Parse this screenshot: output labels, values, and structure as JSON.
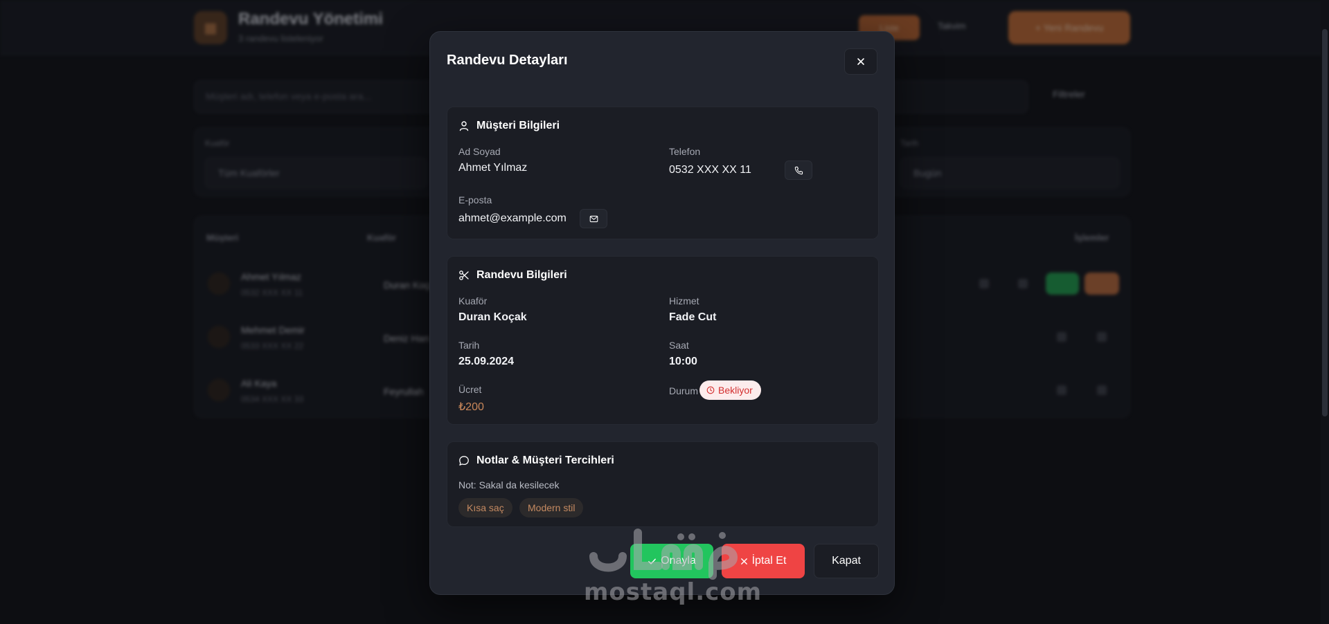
{
  "background": {
    "app_title": "Randevu Yönetimi",
    "app_subtitle": "3 randevu listeleniyor",
    "header_btn_small": "Liste",
    "header_link": "Takvim",
    "header_btn_primary": "+ Yeni Randevu",
    "search_placeholder": "Müşteri adı, telefon veya e-posta ara...",
    "filters_label": "Filtreler",
    "filter_barber_label": "Kuaför",
    "filter_barber_value": "Tüm Kuaförler",
    "filter_date_label": "Tarih",
    "filter_date_value": "Bugün",
    "table_headers": [
      "Müşteri",
      "Kuaför",
      "",
      "İşlemler"
    ],
    "rows": [
      {
        "name": "Ahmet Yılmaz",
        "phone": "0532 XXX XX 11",
        "barber": "Duran Koçak"
      },
      {
        "name": "Mehmet Demir",
        "phone": "0533 XXX XX 22",
        "barber": "Deniz Han"
      },
      {
        "name": "Ali Kaya",
        "phone": "0534 XXX XX 33",
        "barber": "Feyrullah"
      }
    ]
  },
  "modal": {
    "title": "Randevu Detayları",
    "customer": {
      "heading": "Müşteri Bilgileri",
      "name_label": "Ad Soyad",
      "name": "Ahmet Yılmaz",
      "phone_label": "Telefon",
      "phone": "0532 XXX XX 11",
      "email_label": "E-posta",
      "email": "ahmet@example.com"
    },
    "appointment": {
      "heading": "Randevu Bilgileri",
      "barber_label": "Kuaför",
      "barber": "Duran Koçak",
      "service_label": "Hizmet",
      "service": "Fade Cut",
      "date_label": "Tarih",
      "date": "25.09.2024",
      "time_label": "Saat",
      "time": "10:00",
      "price_label": "Ücret",
      "price": "₺200",
      "status_label": "Durum",
      "status": "Bekliyor"
    },
    "notes": {
      "heading": "Notlar & Müşteri Tercihleri",
      "note": "Not: Sakal da kesilecek",
      "tags": [
        "Kısa saç",
        "Modern stil"
      ]
    },
    "actions": {
      "approve": "Onayla",
      "cancel": "İptal Et",
      "close": "Kapat"
    }
  },
  "watermark": "mostaql.com",
  "colors": {
    "approve": "#22c55e",
    "cancel": "#ef4444",
    "accent": "#c9875a",
    "status_bg": "#fdecec",
    "status_fg": "#d32f2f"
  }
}
